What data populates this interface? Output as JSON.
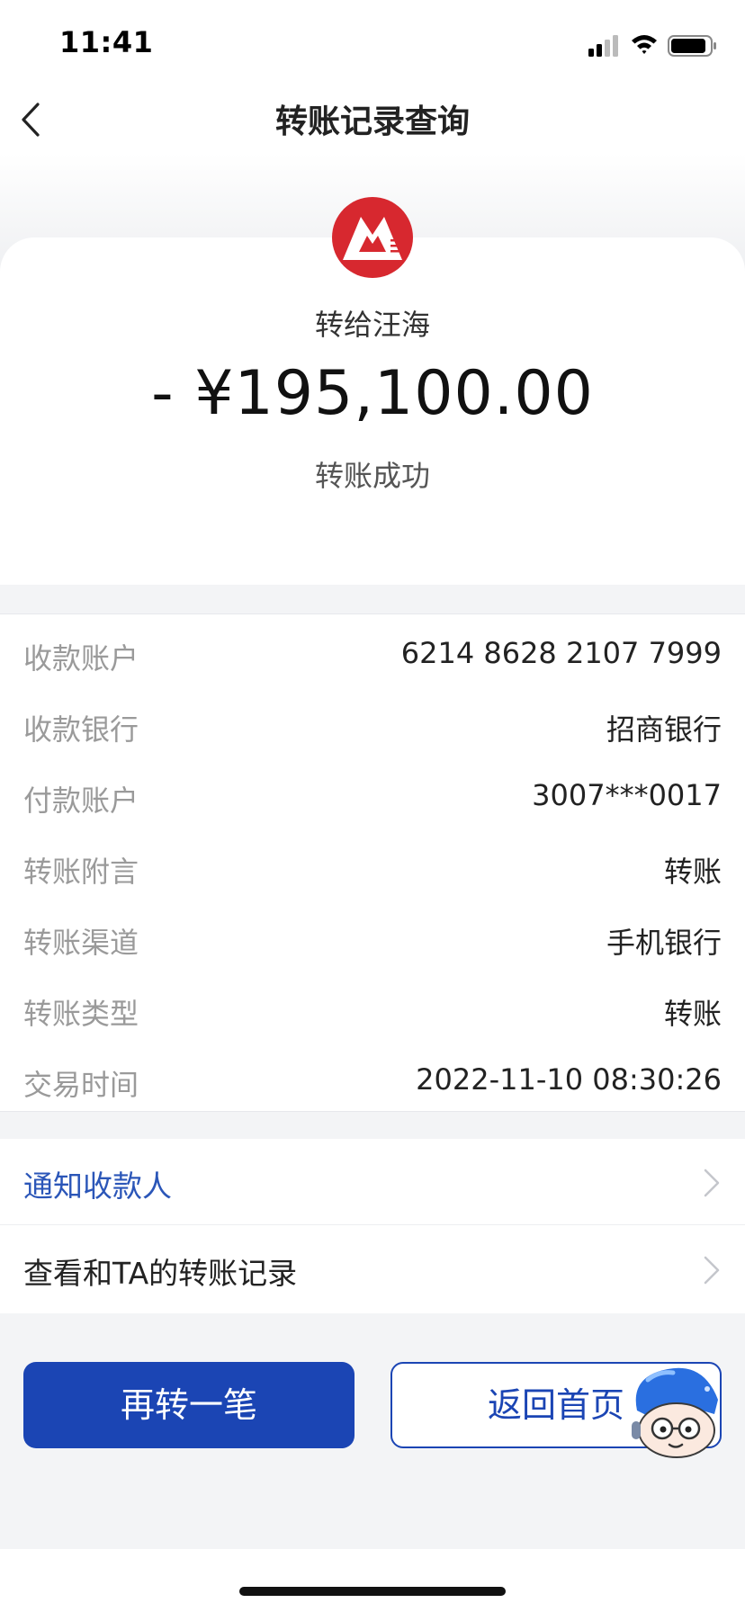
{
  "status_bar": {
    "time": "11:41"
  },
  "nav": {
    "title": "转账记录查询"
  },
  "hero": {
    "recipient": "转给汪海",
    "amount": "- ¥195,100.00",
    "status": "转账成功"
  },
  "details": [
    {
      "label": "收款账户",
      "value": "6214 8628 2107 7999"
    },
    {
      "label": "收款银行",
      "value": "招商银行"
    },
    {
      "label": "付款账户",
      "value": "3007***0017"
    },
    {
      "label": "转账附言",
      "value": "转账"
    },
    {
      "label": "转账渠道",
      "value": "手机银行"
    },
    {
      "label": "转账类型",
      "value": "转账"
    },
    {
      "label": "交易时间",
      "value": "2022-11-10 08:30:26"
    }
  ],
  "actions": {
    "notify": "通知收款人",
    "history": "查看和TA的转账记录"
  },
  "buttons": {
    "transfer_again": "再转一笔",
    "back_home": "返回首页"
  },
  "colors": {
    "accent": "#1b45b4",
    "link": "#2b56b8",
    "logo_red": "#d7282f"
  },
  "icons": [
    "back-icon",
    "signal-icon",
    "wifi-icon",
    "battery-icon",
    "bank-logo",
    "chevron-right-icon",
    "assistant-mascot-icon"
  ]
}
